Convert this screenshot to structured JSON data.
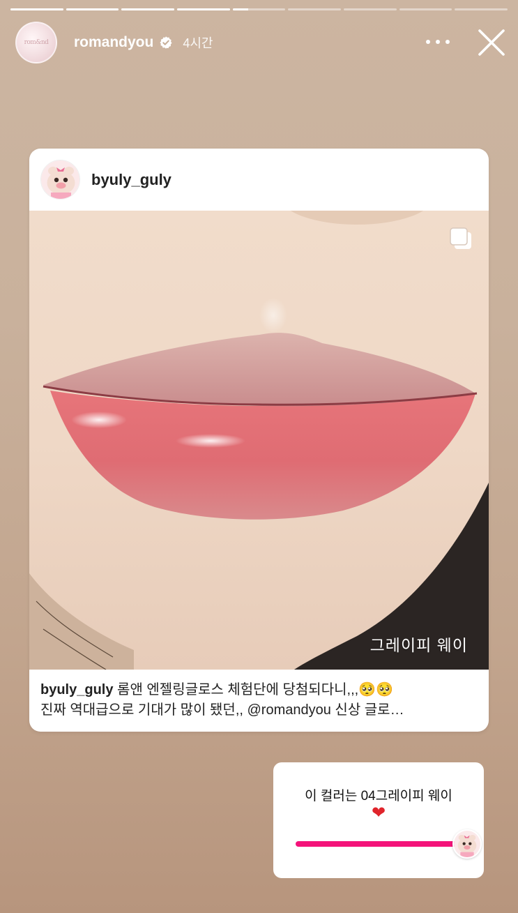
{
  "story": {
    "segment_count": 9,
    "active_segment": 5,
    "active_progress": 0.3,
    "account": "romandyou",
    "avatar_text": "rom&nd",
    "verified": true,
    "time_ago": "4시간",
    "more_icon": "more-dots-icon",
    "close_icon": "close-icon"
  },
  "shared_post": {
    "username": "byuly_guly",
    "image_caption": "그레이피 웨이",
    "carousel_icon": "carousel-icon",
    "caption_user": "byuly_guly",
    "caption_line1": " 롬앤 엔젤링글로스 체험단에 당첨되다니,,,🥺🥺",
    "caption_line2": "진짜 역대급으로 기대가 많이 됐던,, @romandyou 신상 글로…"
  },
  "slider_sticker": {
    "question": "이 컬러는 04그레이피 웨이",
    "emoji": "❤",
    "value": 1.0,
    "track_color": "#f4137a"
  }
}
